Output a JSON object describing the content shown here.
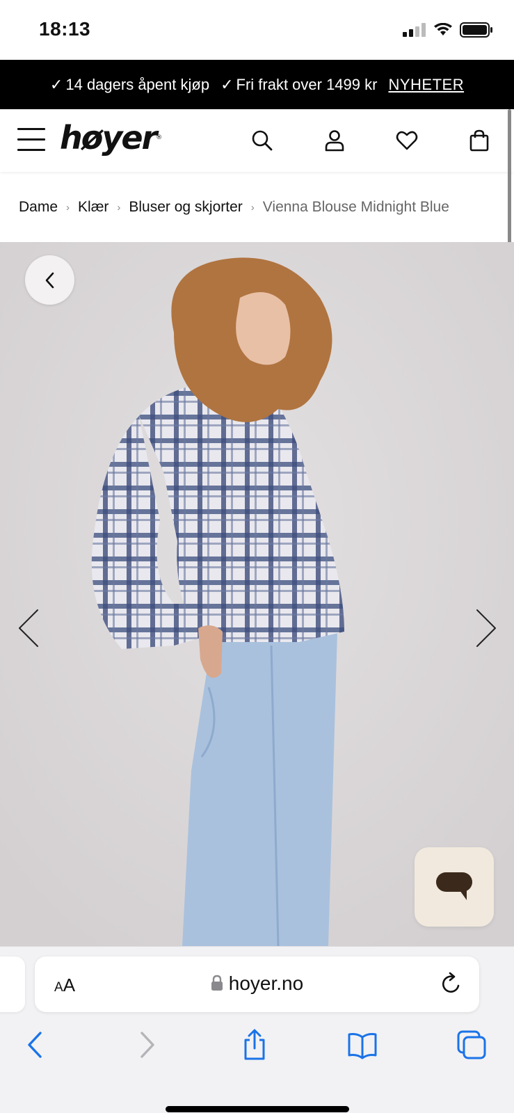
{
  "status_bar": {
    "time": "18:13"
  },
  "promo": {
    "item1": "14 dagers åpent kjøp",
    "item2": "Fri frakt over 1499 kr",
    "link": "NYHETER"
  },
  "header": {
    "logo": "høyer"
  },
  "breadcrumb": {
    "items": [
      "Dame",
      "Klær",
      "Bluser og skjorter"
    ],
    "current": "Vienna Blouse Midnight Blue"
  },
  "browser": {
    "aa_small": "A",
    "aa_large": "A",
    "url": "hoyer.no"
  },
  "colors": {
    "accent_link": "#1a73e8",
    "promo_bg": "#000000",
    "chat_bg": "#f1e9dd"
  }
}
